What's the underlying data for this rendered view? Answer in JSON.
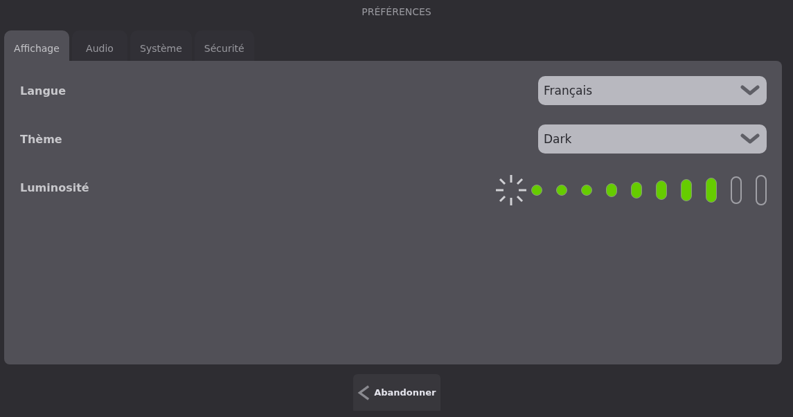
{
  "window": {
    "title": "PRÉFÉRENCES"
  },
  "tabs": [
    {
      "label": "Affichage",
      "selected": true
    },
    {
      "label": "Audio",
      "selected": false
    },
    {
      "label": "Système",
      "selected": false
    },
    {
      "label": "Sécurité",
      "selected": false
    }
  ],
  "settings": [
    {
      "kind": "dropdown",
      "label": "Langue",
      "value": "Français"
    },
    {
      "kind": "dropdown",
      "label": "Thème",
      "value": "Dark"
    },
    {
      "kind": "meter",
      "label": "Luminosité",
      "level": 0.8
    }
  ],
  "buttons": [
    {
      "label": "Abandonner"
    }
  ]
}
